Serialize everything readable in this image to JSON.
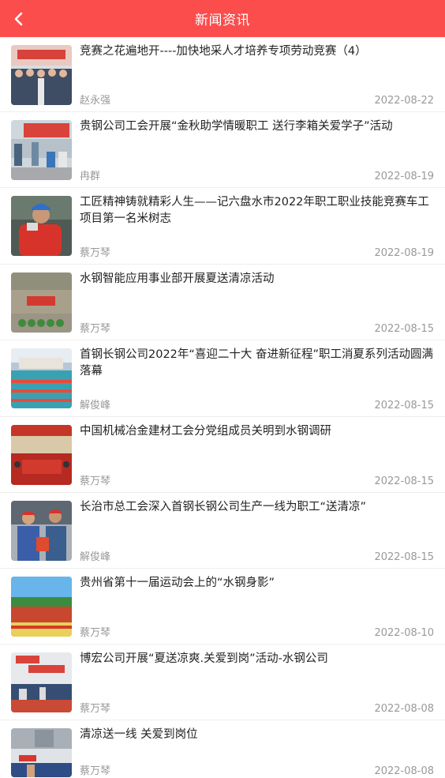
{
  "header": {
    "title": "新闻资讯",
    "background": "#fc4d4d"
  },
  "news": [
    {
      "title": "竞赛之花遍地开----加快地采人才培养专项劳动竞赛（4）",
      "author": "赵永强",
      "date": "2022-08-22"
    },
    {
      "title": "贵钢公司工会开展“金秋助学情暖职工 送行李箱关爱学子”活动",
      "author": "冉群",
      "date": "2022-08-19"
    },
    {
      "title": "工匠精神铸就精彩人生——记六盘水市2022年职工职业技能竞赛车工项目第一名米树志",
      "author": "蔡万琴",
      "date": "2022-08-19"
    },
    {
      "title": "水钢智能应用事业部开展夏送清凉活动",
      "author": "蔡万琴",
      "date": "2022-08-15"
    },
    {
      "title": "首钢长钢公司2022年“喜迎二十大 奋进新征程”职工消夏系列活动圆满落幕",
      "author": "解俊峰",
      "date": "2022-08-15"
    },
    {
      "title": "中国机械冶金建材工会分党组成员关明到水钢调研",
      "author": "蔡万琴",
      "date": "2022-08-15"
    },
    {
      "title": "长治市总工会深入首钢长钢公司生产一线为职工“送清凉”",
      "author": "解俊峰",
      "date": "2022-08-15"
    },
    {
      "title": "贵州省第十一届运动会上的“水钢身影”",
      "author": "蔡万琴",
      "date": "2022-08-10"
    },
    {
      "title": "博宏公司开展“夏送凉爽.关爱到岗”活动-水钢公司",
      "author": "蔡万琴",
      "date": "2022-08-08"
    },
    {
      "title": "清凉送一线 关爱到岗位",
      "author": "蔡万琴",
      "date": "2022-08-08"
    }
  ]
}
